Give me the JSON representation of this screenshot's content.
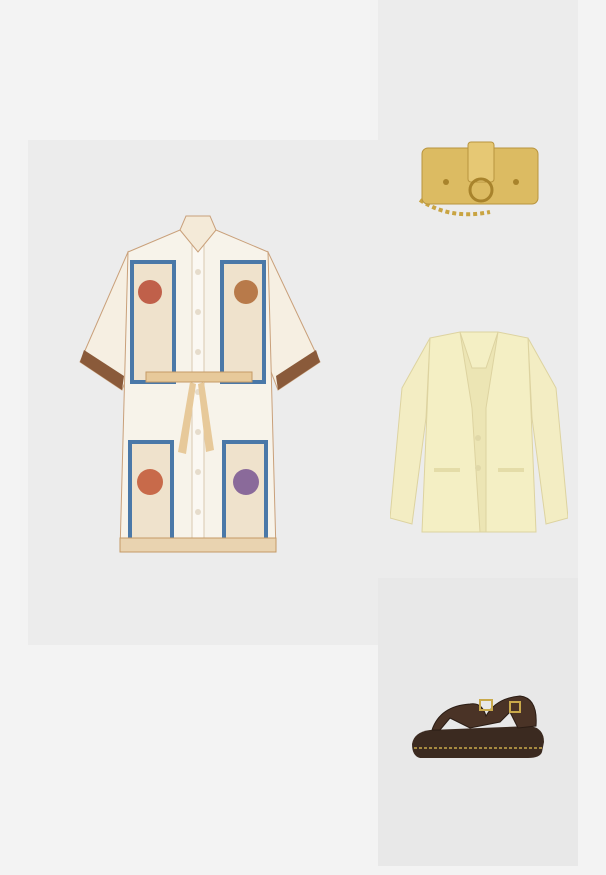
{
  "layout": {
    "background": "#f3f3f3",
    "panel_color": "#ececec"
  },
  "items": [
    {
      "name": "dress",
      "kind": "printed shirt dress with belt",
      "colors": [
        "#f7f3ea",
        "#c88a5a",
        "#4a78a8",
        "#8a5a3a"
      ]
    },
    {
      "name": "bag",
      "kind": "gold metallic crossbody bag",
      "colors": [
        "#d9b760",
        "#b8943e"
      ]
    },
    {
      "name": "blazer",
      "kind": "pale yellow blazer",
      "colors": [
        "#f4efc4",
        "#e4dca8"
      ]
    },
    {
      "name": "sandals",
      "kind": "dark brown leather sandals",
      "colors": [
        "#3b2a20",
        "#c9a94a"
      ]
    }
  ]
}
